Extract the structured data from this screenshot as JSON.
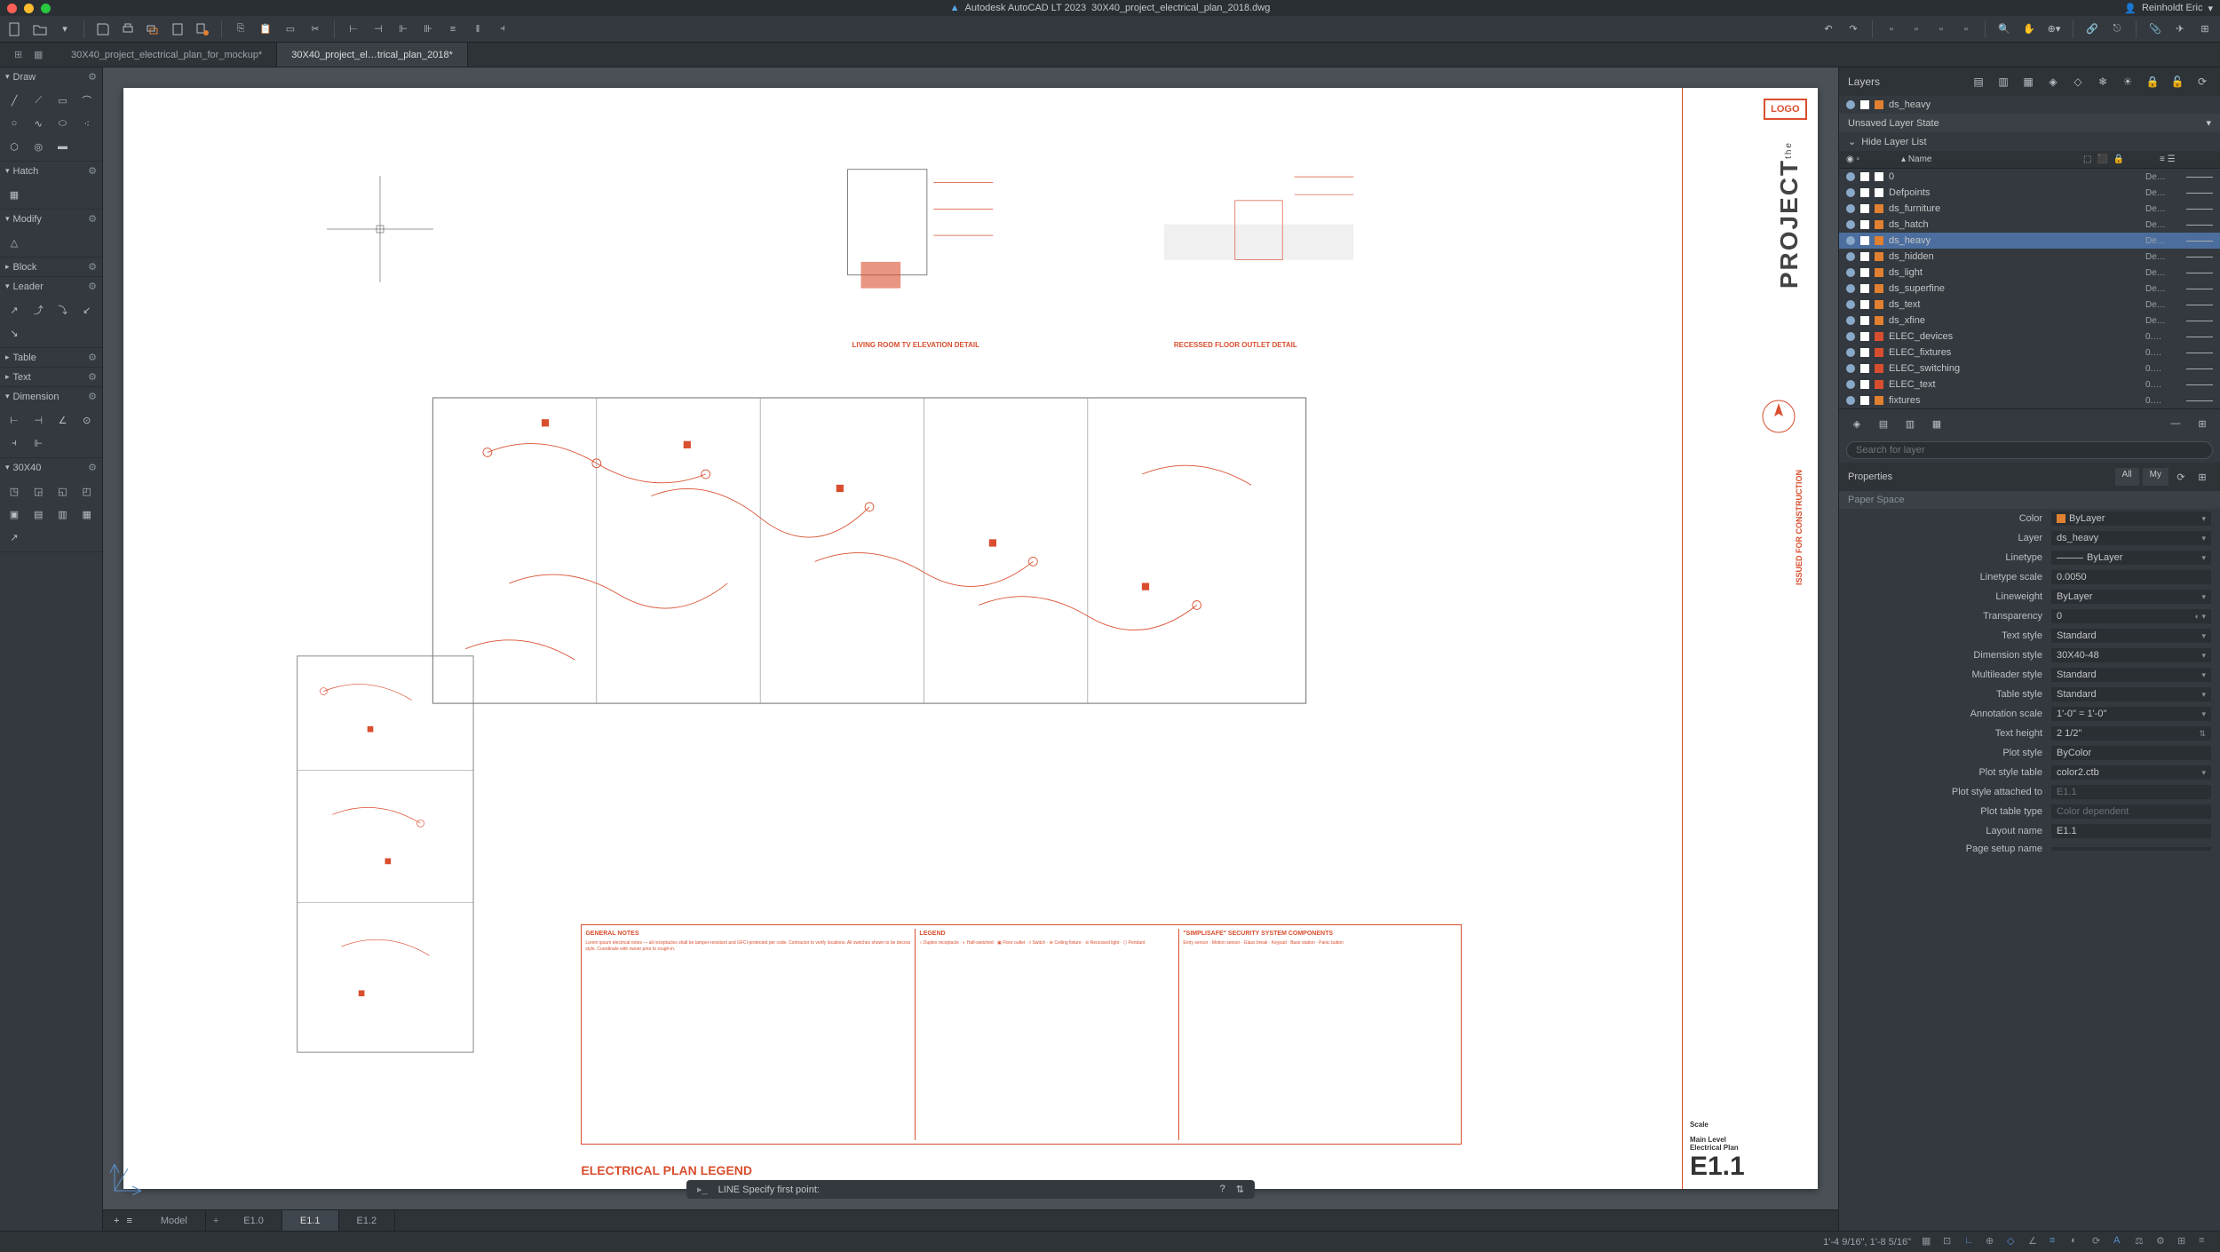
{
  "titlebar": {
    "app_name": "Autodesk AutoCAD LT 2023",
    "filename": "30X40_project_electrical_plan_2018.dwg",
    "user": "Reinholdt Eric"
  },
  "file_tabs": [
    {
      "label": "30X40_project_electrical_plan_for_mockup*",
      "active": false
    },
    {
      "label": "30X40_project_el…trical_plan_2018*",
      "active": true
    }
  ],
  "left_palette": {
    "sections": [
      {
        "title": "Draw"
      },
      {
        "title": "Hatch"
      },
      {
        "title": "Modify"
      },
      {
        "title": "Block"
      },
      {
        "title": "Leader"
      },
      {
        "title": "Table"
      },
      {
        "title": "Text"
      },
      {
        "title": "Dimension"
      },
      {
        "title": "30X40"
      }
    ]
  },
  "layout_tabs": [
    "Model",
    "E1.0",
    "E1.1",
    "E1.2"
  ],
  "layout_tabs_active": "E1.1",
  "command": {
    "prompt": "LINE Specify first point:"
  },
  "drawing": {
    "detail1_label": "LIVING ROOM TV ELEVATION DETAIL",
    "detail2_label": "RECESSED FLOOR OUTLET DETAIL",
    "legend_title": "ELECTRICAL PLAN LEGEND",
    "legend_headers": [
      "GENERAL NOTES",
      "LEGEND",
      "\"SIMPLISAFE\" SECURITY SYSTEM COMPONENTS"
    ],
    "title_block": {
      "logo": "LOGO",
      "project": "PROJECT",
      "the": "the",
      "issued": "ISSUED FOR CONSTRUCTION",
      "sheet_title_scale": "Scale",
      "sheet_title_level": "Main Level",
      "sheet_title_plan": "Electrical Plan",
      "sheet_num": "E1.1"
    }
  },
  "layers": {
    "header": "Layers",
    "state": "Unsaved Layer State",
    "hide_label": "Hide Layer List",
    "col_name": "Name",
    "rows": [
      {
        "name": "0",
        "color": "#ffffff",
        "end": "De…"
      },
      {
        "name": "Defpoints",
        "color": "#ffffff",
        "end": "De…"
      },
      {
        "name": "ds_furniture",
        "color": "#e08030",
        "end": "De…"
      },
      {
        "name": "ds_hatch",
        "color": "#e08030",
        "end": "De…"
      },
      {
        "name": "ds_heavy",
        "color": "#e08030",
        "end": "De…",
        "selected": true
      },
      {
        "name": "ds_hidden",
        "color": "#e08030",
        "end": "De…"
      },
      {
        "name": "ds_light",
        "color": "#e08030",
        "end": "De…"
      },
      {
        "name": "ds_superfine",
        "color": "#e08030",
        "end": "De…"
      },
      {
        "name": "ds_text",
        "color": "#e08030",
        "end": "De…"
      },
      {
        "name": "ds_xfine",
        "color": "#e08030",
        "end": "De…"
      },
      {
        "name": "ELEC_devices",
        "color": "#d94e2e",
        "end": "0.…"
      },
      {
        "name": "ELEC_fixtures",
        "color": "#d94e2e",
        "end": "0.…"
      },
      {
        "name": "ELEC_switching",
        "color": "#d94e2e",
        "end": "0.…"
      },
      {
        "name": "ELEC_text",
        "color": "#d94e2e",
        "end": "0.…"
      },
      {
        "name": "fixtures",
        "color": "#e08030",
        "end": "0.…"
      }
    ],
    "search_placeholder": "Search for layer",
    "current_layer": "ds_heavy"
  },
  "properties": {
    "header": "Properties",
    "tab_all": "All",
    "tab_my": "My",
    "space": "Paper Space",
    "rows": [
      {
        "label": "Color",
        "value": "ByLayer",
        "swatch": true,
        "dropdown": true
      },
      {
        "label": "Layer",
        "value": "ds_heavy",
        "dropdown": true
      },
      {
        "label": "Linetype",
        "value": "ByLayer",
        "dropdown": true,
        "line": true
      },
      {
        "label": "Linetype scale",
        "value": "0.0050"
      },
      {
        "label": "Lineweight",
        "value": "ByLayer",
        "dropdown": true
      },
      {
        "label": "Transparency",
        "value": "0",
        "slider": true
      },
      {
        "label": "Text style",
        "value": "Standard",
        "dropdown": true
      },
      {
        "label": "Dimension style",
        "value": "30X40-48",
        "dropdown": true
      },
      {
        "label": "Multileader style",
        "value": "Standard",
        "dropdown": true
      },
      {
        "label": "Table style",
        "value": "Standard",
        "dropdown": true
      },
      {
        "label": "Annotation scale",
        "value": "1'-0\" = 1'-0\"",
        "dropdown": true
      },
      {
        "label": "Text height",
        "value": "2 1/2\"",
        "extra_icon": true
      },
      {
        "label": "Plot style",
        "value": "ByColor"
      },
      {
        "label": "Plot style table",
        "value": "color2.ctb",
        "dropdown": true
      },
      {
        "label": "Plot style attached to",
        "value": "E1.1",
        "dim": true
      },
      {
        "label": "Plot table type",
        "value": "Color dependent",
        "dim": true
      },
      {
        "label": "Layout name",
        "value": "E1.1"
      },
      {
        "label": "Page setup name",
        "value": ""
      }
    ]
  },
  "statusbar": {
    "coords": "1'-4 9/16\",   1'-8 5/16\""
  }
}
